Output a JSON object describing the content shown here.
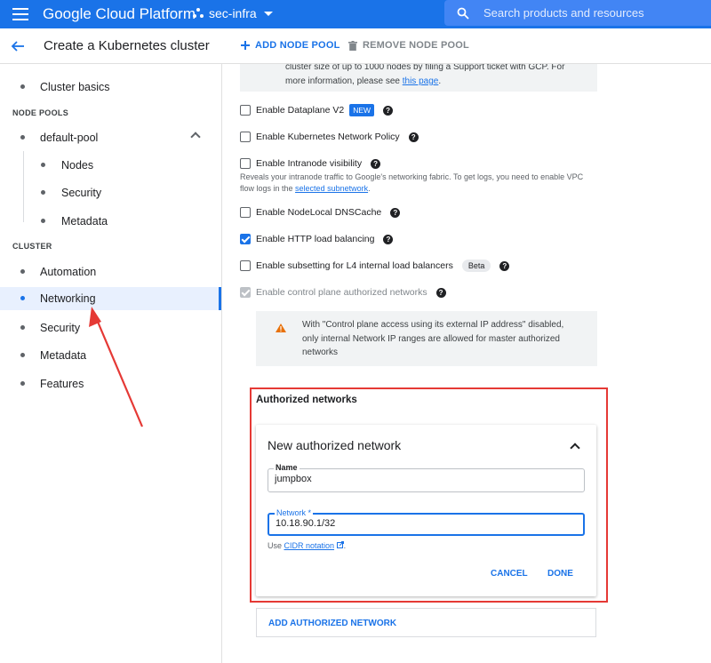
{
  "topbar": {
    "app_title": "Google Cloud Platform",
    "project": "sec-infra",
    "search_placeholder": "Search products and resources"
  },
  "header": {
    "page_title": "Create a Kubernetes cluster",
    "add_node_pool": "ADD NODE POOL",
    "remove_node_pool": "REMOVE NODE POOL"
  },
  "sidebar": {
    "cluster_basics": "Cluster basics",
    "node_pools_heading": "NODE POOLS",
    "default_pool": "default-pool",
    "nodes": "Nodes",
    "pool_security": "Security",
    "pool_metadata": "Metadata",
    "cluster_heading": "CLUSTER",
    "automation": "Automation",
    "networking": "Networking",
    "security": "Security",
    "metadata": "Metadata",
    "features": "Features"
  },
  "main": {
    "info_line1": "cluster size of up to 1000 nodes by filing a Support ticket with GCP. For",
    "info_line2_prefix": "more information, please see ",
    "info_link": "this page",
    "info_suffix": ".",
    "options": {
      "dataplane": "Enable Dataplane V2",
      "new_badge": "NEW",
      "network_policy": "Enable Kubernetes Network Policy",
      "intranode": "Enable Intranode visibility",
      "intranode_desc1": "Reveals your intranode traffic to Google's networking fabric. To get logs, you need to enable VPC",
      "intranode_desc2_prefix": "flow logs in the ",
      "intranode_desc_link": "selected subnetwork",
      "intranode_desc_suffix": ".",
      "nodelocal_dns": "Enable NodeLocal DNSCache",
      "http_lb": "Enable HTTP load balancing",
      "subsetting": "Enable subsetting for L4 internal load balancers",
      "beta_badge": "Beta",
      "control_plane": "Enable control plane authorized networks"
    },
    "warning_line1": "With \"Control plane access using its external IP address\" disabled,",
    "warning_line2": "only internal Network IP ranges are allowed for master authorized",
    "warning_line3": "networks",
    "authorized_networks_title": "Authorized networks",
    "card": {
      "title": "New authorized network",
      "name_label": "Name",
      "name_value": "jumpbox",
      "network_label": "Network *",
      "network_value": "10.18.90.1/32",
      "hint_prefix": "Use ",
      "hint_link": "CIDR notation",
      "hint_suffix": ".",
      "cancel": "CANCEL",
      "done": "DONE"
    },
    "add_authorized_network": "ADD AUTHORIZED NETWORK"
  },
  "colors": {
    "brand_blue": "#1a73e8",
    "annotation_red": "#e53935",
    "warning_orange": "#e8710a"
  },
  "icons": [
    "menu-icon",
    "project-icon",
    "search-icon",
    "back-arrow-icon",
    "add-icon",
    "trash-icon",
    "help-icon",
    "warning-icon",
    "external-link-icon",
    "chevron-up-icon"
  ]
}
